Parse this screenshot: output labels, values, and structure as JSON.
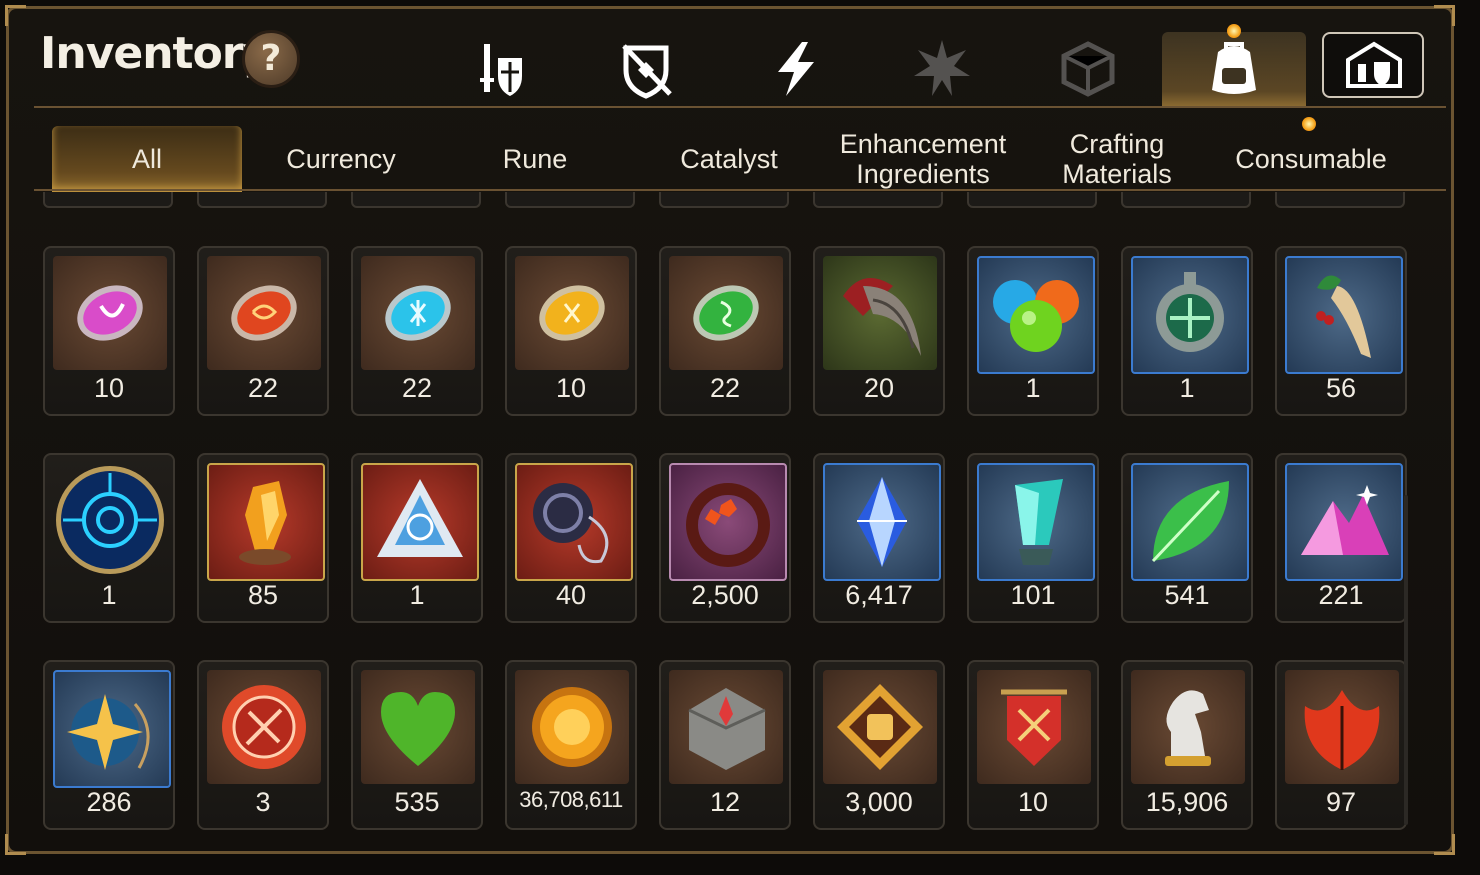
{
  "header": {
    "title": "Inventory",
    "help_label": "?",
    "top_tabs": [
      {
        "icon": "sword-shield-icon"
      },
      {
        "icon": "crossed-shield-icon"
      },
      {
        "icon": "lightning-icon"
      },
      {
        "icon": "burst-icon"
      },
      {
        "icon": "cube-icon"
      },
      {
        "icon": "backpack-icon",
        "active": true
      },
      {
        "icon": "castle-icon"
      }
    ]
  },
  "categories": [
    {
      "label": "All",
      "active": true
    },
    {
      "label": "Currency"
    },
    {
      "label": "Rune"
    },
    {
      "label": "Catalyst"
    },
    {
      "label": "Enhancement Ingredients"
    },
    {
      "label": "Crafting Materials"
    },
    {
      "label": "Consumable"
    }
  ],
  "items_row1": [
    {
      "icon": "pink-rune-icon",
      "qty": "10"
    },
    {
      "icon": "red-rune-icon",
      "qty": "22"
    },
    {
      "icon": "blue-rune-icon",
      "qty": "22"
    },
    {
      "icon": "yellow-rune-icon",
      "qty": "10"
    },
    {
      "icon": "green-rune-icon",
      "qty": "22"
    },
    {
      "icon": "claw-icon",
      "qty": "20"
    },
    {
      "icon": "orbs-icon",
      "qty": "1"
    },
    {
      "icon": "medallion-icon",
      "qty": "1"
    },
    {
      "icon": "ginseng-icon",
      "qty": "56"
    }
  ],
  "items_row2": [
    {
      "icon": "portal-disc-icon",
      "qty": "1"
    },
    {
      "icon": "fire-crystal-icon",
      "qty": "85"
    },
    {
      "icon": "triangle-gem-icon",
      "qty": "1"
    },
    {
      "icon": "necklace-icon",
      "qty": "40"
    },
    {
      "icon": "flower-ring-icon",
      "qty": "2,500"
    },
    {
      "icon": "blue-crystal-icon",
      "qty": "6,417"
    },
    {
      "icon": "teal-prism-icon",
      "qty": "101"
    },
    {
      "icon": "leaf-icon",
      "qty": "541"
    },
    {
      "icon": "pink-crystals-icon",
      "qty": "221"
    }
  ],
  "items_row3": [
    {
      "icon": "star-amulet-icon",
      "qty": "286"
    },
    {
      "icon": "seal-badge-icon",
      "qty": "3"
    },
    {
      "icon": "green-heart-icon",
      "qty": "535"
    },
    {
      "icon": "gold-coin-icon",
      "qty": "36,708,611"
    },
    {
      "icon": "stone-compass-icon",
      "qty": "12"
    },
    {
      "icon": "fist-emblem-icon",
      "qty": "3,000"
    },
    {
      "icon": "war-banner-icon",
      "qty": "10"
    },
    {
      "icon": "chess-knight-icon",
      "qty": "15,906"
    },
    {
      "icon": "red-leaf-icon",
      "qty": "97"
    }
  ],
  "colors": {
    "accent": "#b08c4f",
    "frame": "#6b5431",
    "notification": "#f4a21a"
  }
}
